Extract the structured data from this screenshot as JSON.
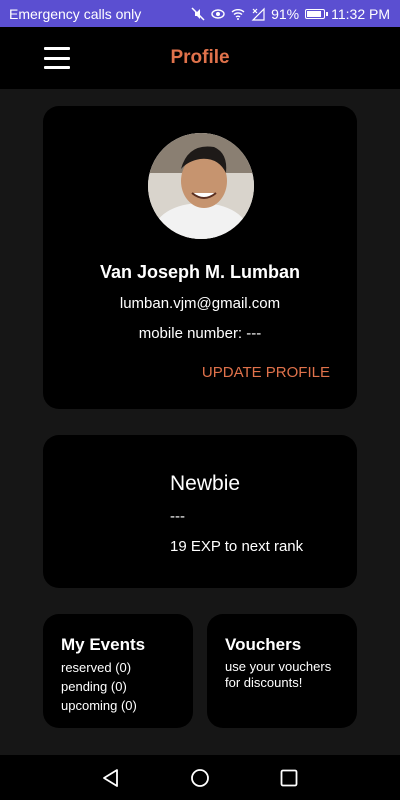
{
  "status_bar": {
    "carrier": "Emergency calls only",
    "battery": "91%",
    "battery_level": 0.91,
    "time": "11:32 PM"
  },
  "app_bar": {
    "title": "Profile",
    "menu_icon": "hamburger-menu-icon",
    "accent_color": "#e0724b"
  },
  "profile": {
    "name": "Van Joseph M. Lumban",
    "email": "lumban.vjm@gmail.com",
    "mobile": "mobile number: ---",
    "update_label": "UPDATE PROFILE"
  },
  "rank": {
    "name": "Newbie",
    "subtitle": "---",
    "exp_text": "19 EXP to next rank"
  },
  "events": {
    "title": "My Events",
    "lines": [
      "reserved (0)",
      "pending (0)",
      "upcoming (0)"
    ]
  },
  "vouchers": {
    "title": "Vouchers",
    "description": "use your vouchers for discounts!"
  },
  "nav_bar": {
    "back_icon": "back-triangle-icon",
    "home_icon": "home-circle-icon",
    "recents_icon": "recents-square-icon"
  }
}
